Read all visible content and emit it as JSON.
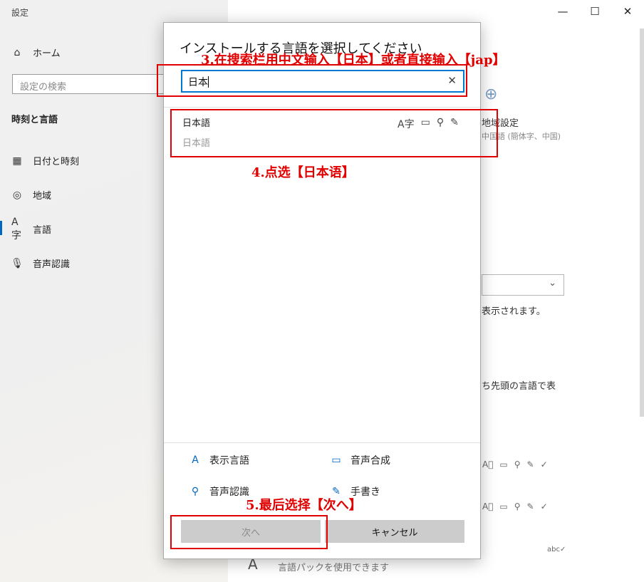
{
  "app": {
    "title": "設定"
  },
  "window_controls": {
    "minimize": "—",
    "maximize": "☐",
    "close": "✕"
  },
  "sidebar": {
    "home": "ホーム",
    "search_placeholder": "設定の検索",
    "section": "時刻と言語",
    "items": [
      {
        "label": "日付と時刻",
        "icon": "calendar-clock-icon"
      },
      {
        "label": "地域",
        "icon": "globe-region-icon"
      },
      {
        "label": "言語",
        "icon": "language-icon",
        "selected": true
      },
      {
        "label": "音声認識",
        "icon": "microphone-icon"
      }
    ]
  },
  "background": {
    "region_setting": "地域設定",
    "region_sub": "中国語 (簡体字、中国)",
    "shown_text": "表示されます。",
    "first_lang_text": "ち先頭の言語で表",
    "lang_pack_text": "言語パックを使用できます"
  },
  "dialog": {
    "title": "インストールする言語を選択してください",
    "search_value": "日本",
    "result": {
      "name": "日本語",
      "native": "日本語"
    },
    "features": [
      {
        "label": "表示言語",
        "icon": "display-language-icon"
      },
      {
        "label": "音声合成",
        "icon": "text-to-speech-icon"
      },
      {
        "label": "音声認識",
        "icon": "speech-recognition-icon"
      },
      {
        "label": "手書き",
        "icon": "handwriting-icon"
      }
    ],
    "next_label": "次へ",
    "cancel_label": "キャンセル"
  },
  "annotations": {
    "step3": "3.在搜索栏用中文输入【日本】或者直接输入【jap】",
    "step4": "4.点选【日本语】",
    "step5": "5.最后选择【次へ】",
    "color": "#e00000"
  },
  "colors": {
    "accent": "#0078d4",
    "annotation": "#e00000"
  }
}
